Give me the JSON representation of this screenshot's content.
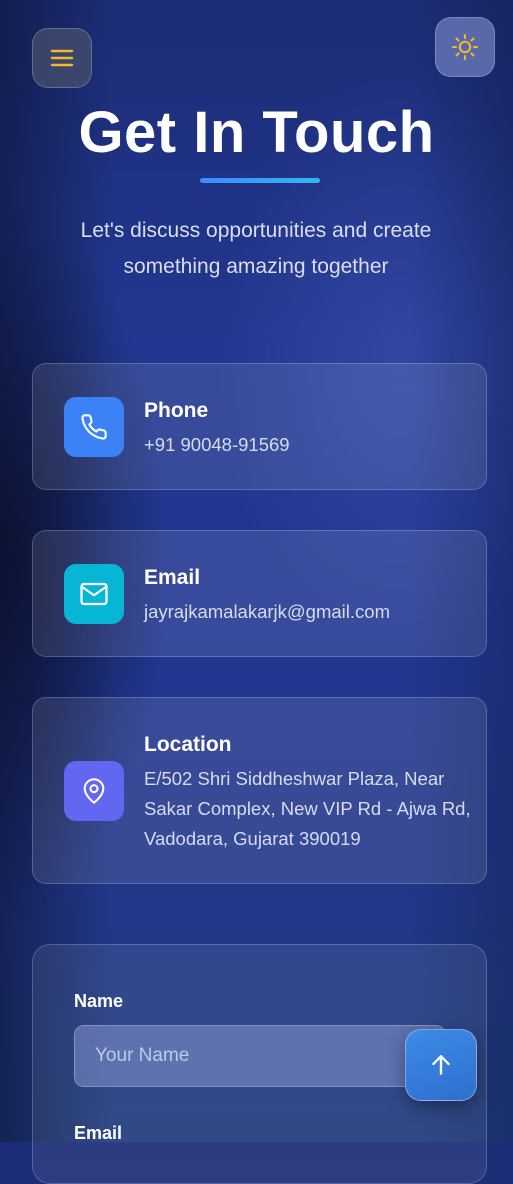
{
  "header": {
    "menu_icon": "hamburger-menu-icon",
    "theme_icon": "sun-icon",
    "title": "Get In Touch",
    "subtitle": "Let's discuss opportunities and create something amazing together"
  },
  "contacts": [
    {
      "icon": "phone-icon",
      "label": "Phone",
      "value": "+91 90048-91569",
      "icon_color": "#3b82f6"
    },
    {
      "icon": "mail-icon",
      "label": "Email",
      "value": "jayrajkamalakarjk@gmail.com",
      "icon_color": "#06b6d4"
    },
    {
      "icon": "map-pin-icon",
      "label": "Location",
      "value": "E/502 Shri Siddheshwar Plaza, Near Sakar Complex, New VIP Rd - Ajwa Rd, Vadodara, Gujarat 390019",
      "icon_color": "#6366f1"
    }
  ],
  "form": {
    "name_label": "Name",
    "name_placeholder": "Your Name",
    "email_label": "Email"
  },
  "scroll_top_icon": "arrow-up-icon",
  "colors": {
    "accent": "#3b82f6",
    "sun": "#f5b82e",
    "menu_lines": "#f5b82e"
  }
}
